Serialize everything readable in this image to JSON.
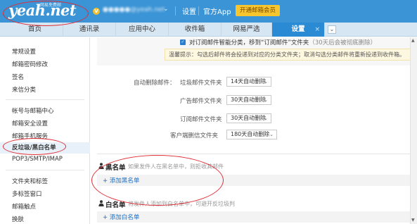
{
  "header": {
    "logo": "yeah.net",
    "logo_sub": "网易免费邮",
    "account": "●●●●●@yeah.net",
    "links": [
      "设置",
      "官方App"
    ],
    "vip_button": "开通邮箱会员"
  },
  "tabs": [
    {
      "label": "首页"
    },
    {
      "label": "通讯录"
    },
    {
      "label": "应用中心"
    },
    {
      "label": "收件箱"
    },
    {
      "label": "网易严选"
    },
    {
      "label": "设置",
      "active": true
    }
  ],
  "tab_close": "×",
  "tab_more": "⌄",
  "sidebar": {
    "items": [
      "常规设置",
      "邮箱密码修改",
      "签名",
      "来信分类",
      "帐号与邮箱中心",
      "邮箱安全设置",
      "邮箱手机服务",
      "反垃圾/黑白名单",
      "POP3/SMTP/IMAP",
      "文件夹和标签",
      "多标签窗口",
      "邮箱触点",
      "换肤"
    ],
    "active_index": 7
  },
  "settings": {
    "subscribe_checkbox_text": "对订阅邮件智能分类，移到“订阅邮件”文件夹",
    "subscribe_checkbox_note": "（30天后会被彻底删除）",
    "tip": "温馨提示：勾选后邮件将会投递到对应的分类文件夹；取消勾选分类邮件将重新投递到收件箱。",
    "auto_delete_label": "自动删除邮件：",
    "folders": [
      {
        "label": "垃圾邮件文件夹",
        "value": "14天自动删除"
      },
      {
        "label": "广告邮件文件夹",
        "value": "30天自动删除"
      },
      {
        "label": "订阅邮件文件夹",
        "value": "30天自动删除"
      },
      {
        "label": "客户端删信文件夹",
        "value": "180天自动删除"
      }
    ]
  },
  "blacklist": {
    "title": "黑名单",
    "desc": "如果发件人在黑名单中，则拒收其邮件",
    "add_link": "+ 添加黑名单"
  },
  "whitelist": {
    "title": "白名单",
    "desc": "将发件人添加到白名单中，可避开反垃圾判",
    "add_link": "+ 添加白名单"
  },
  "colors": {
    "header_bg": "#3a94d6",
    "active_tab": "#2a8ad4",
    "link": "#1a6fc4",
    "vip": "#f7c62f",
    "annotation": "#e02d36"
  }
}
